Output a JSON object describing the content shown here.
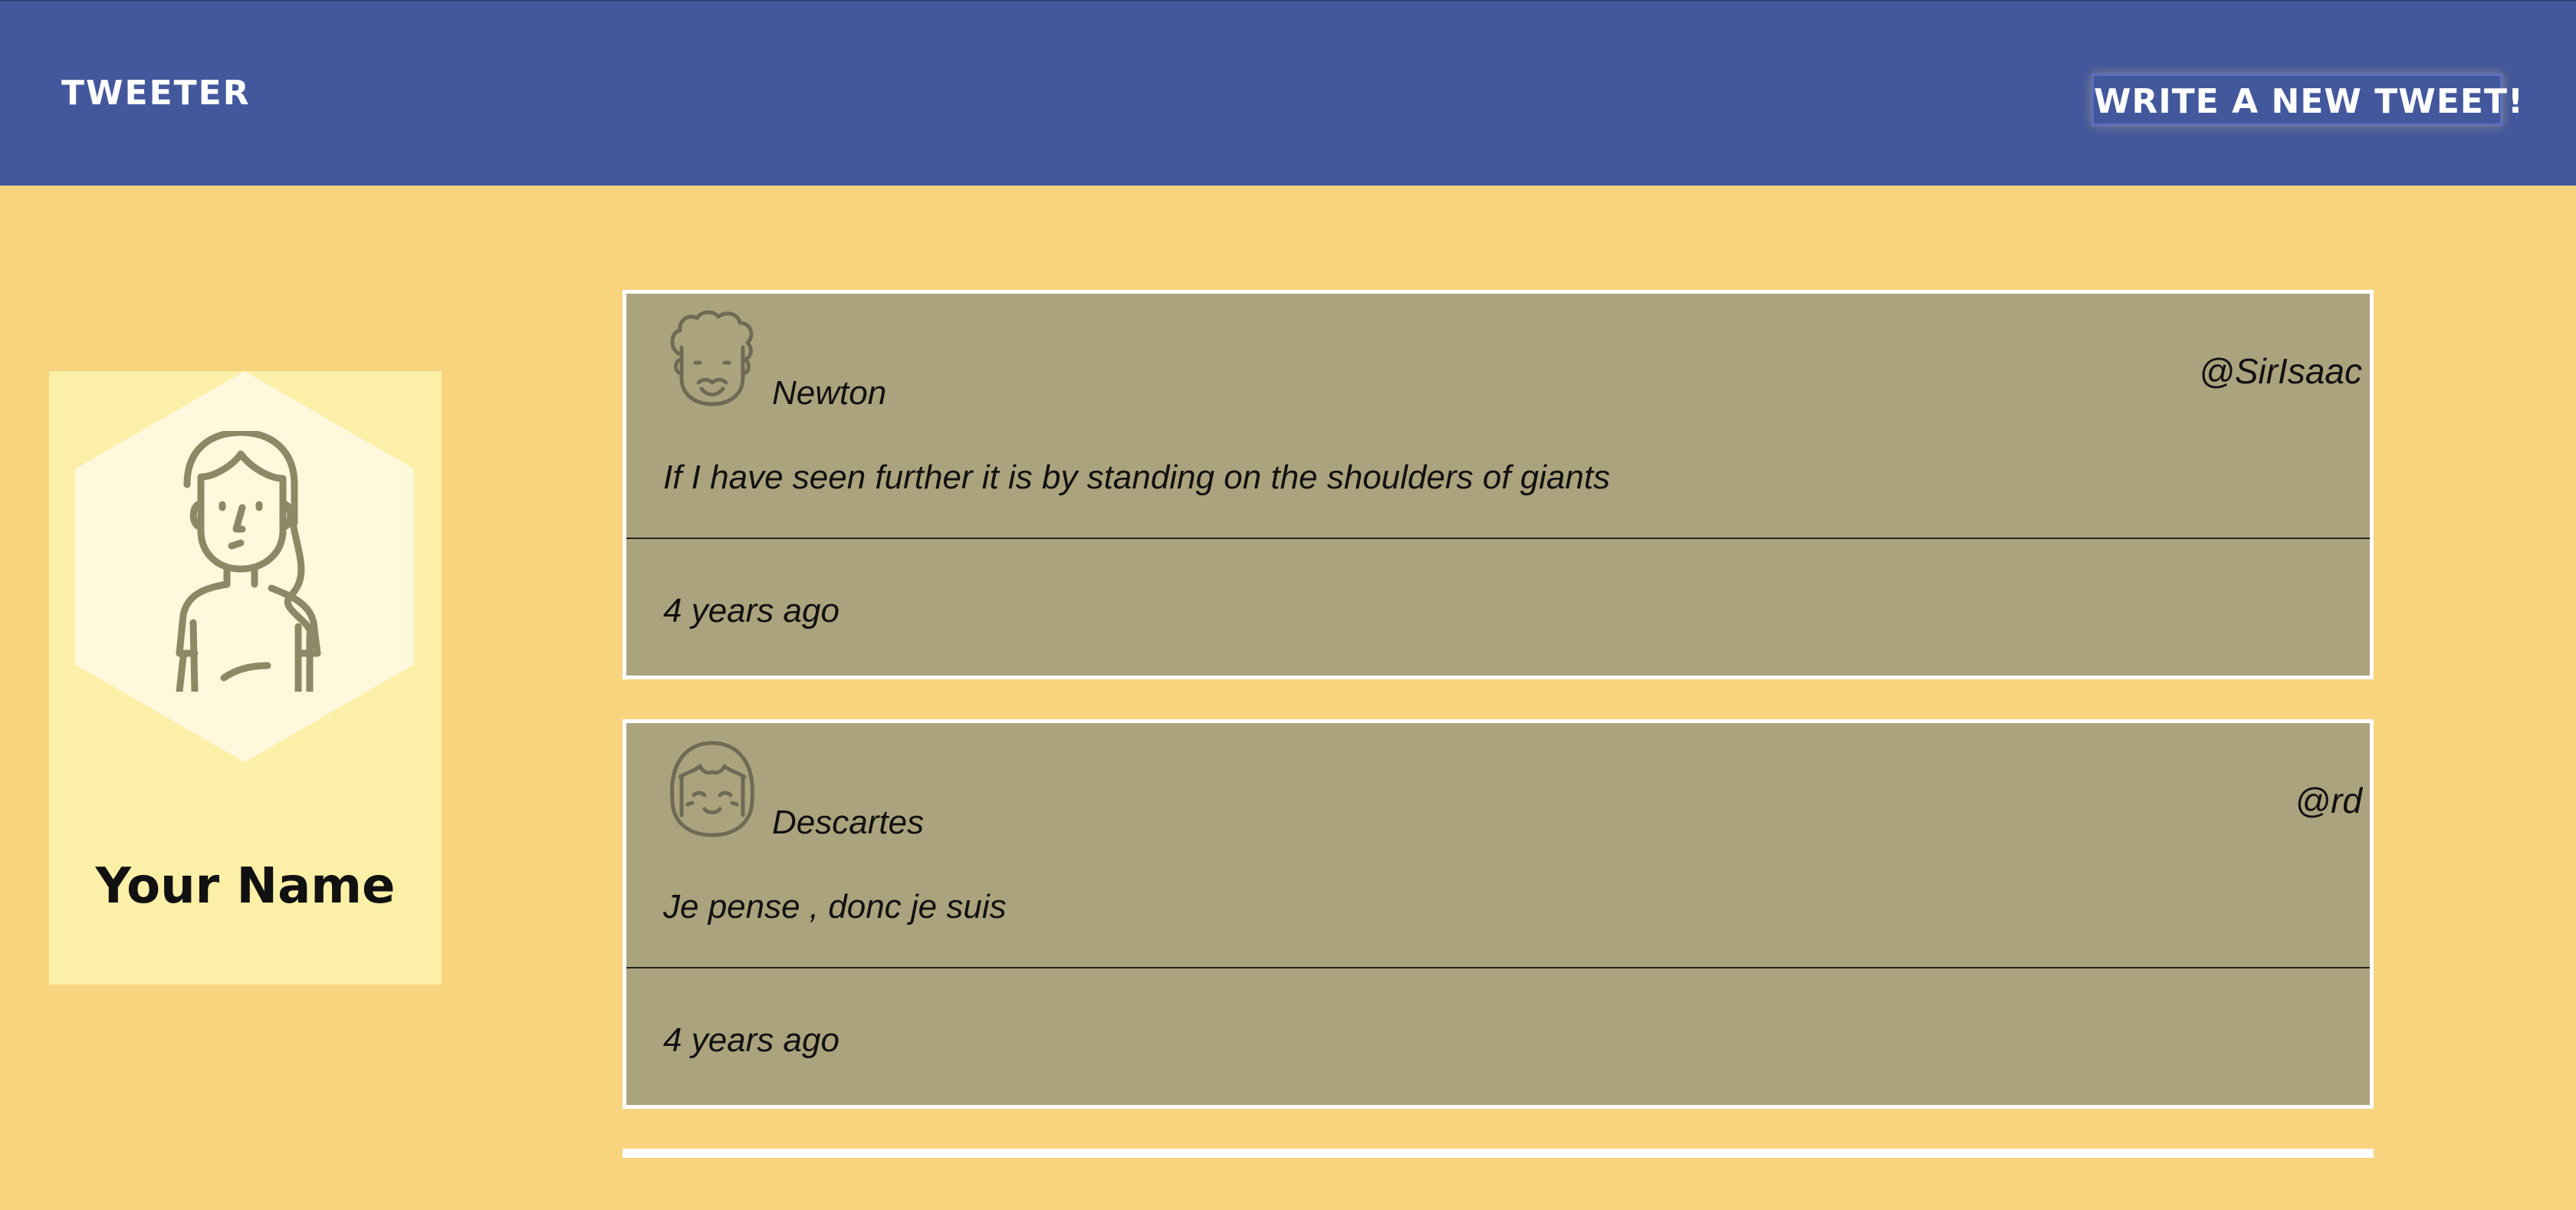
{
  "nav": {
    "brand": "TWEETER",
    "compose_label": "WRITE A NEW TWEET!"
  },
  "profile": {
    "name": "Your Name",
    "avatar_icon": "woman-avatar-icon"
  },
  "tweets": [
    {
      "author": "Newton",
      "handle": "@SirIsaac",
      "text": "If I have seen further it is by standing on the shoulders of giants",
      "time": "4 years ago",
      "avatar_icon": "curly-hair-man-avatar-icon"
    },
    {
      "author": "Descartes",
      "handle": "@rd",
      "text": "Je pense , donc je suis",
      "time": "4 years ago",
      "avatar_icon": "bob-hair-woman-avatar-icon"
    }
  ],
  "colors": {
    "nav_bg": "#43589c",
    "page_bg": "#f8d47e",
    "profile_card_bg": "#fcefa7",
    "hexagon_bg": "#fff8dd",
    "tweet_bg": "#aba37d",
    "tweet_border": "#ffffff"
  }
}
